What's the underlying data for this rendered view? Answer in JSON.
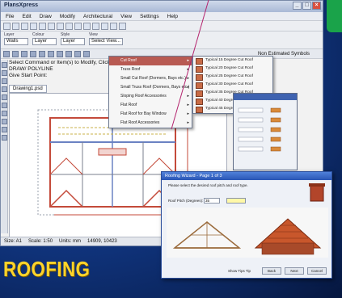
{
  "app": {
    "title": "PlansXpress",
    "menu": [
      "File",
      "Edit",
      "Draw",
      "Modify",
      "Architectural",
      "View",
      "Settings",
      "Help"
    ],
    "props": {
      "layer_label": "Layer",
      "layer_value": "Walls",
      "colour_label": "Colour",
      "colour_value": "Layer",
      "style_label": "Style",
      "style_value": "Layer",
      "view_label": "View",
      "view_value": "Select View..."
    },
    "non_estimated": "Non Estimated Symbols",
    "command_lines": [
      "Select Command or Item(s) to Modify, Click & Drag",
      "DRAW/ POLYLINE",
      "Give Start Point:"
    ],
    "tab": "Drawing1.psd",
    "status": {
      "sheet": "Size: A1",
      "scale": "Scale: 1:50",
      "units": "Units: mm",
      "coords": "14909, 10423"
    }
  },
  "menu_popup": {
    "items": [
      "Cut Roof",
      "Truss Roof",
      "Small Cut Roof (Dormers, Bays etc.)",
      "Small Truss Roof (Dormers, Bays etc.)",
      "Sloping Roof Accessories",
      "Flat Roof",
      "Flat Roof for Bay Window",
      "Flat Roof Accessories"
    ],
    "selected_index": 0
  },
  "submenu": {
    "items": [
      "Typical 15 Degree Cut Roof",
      "Typical 20 Degree Cut Roof",
      "Typical 25 Degree Cut Roof",
      "Typical 30 Degree Cut Roof",
      "Typical 35 Degree Cut Roof",
      "Typical 40 Degree Cut Roof",
      "Typical 45 Degree Cut Roof"
    ]
  },
  "dialog": {
    "title": "Roofing Wizard - Page 1 of 3",
    "intro": "Please select the desired roof pitch and roof type.",
    "pitch_label": "Roof Pitch (Degrees):",
    "pitch_value": "35",
    "footer": "Show Tips Tip",
    "buttons": [
      "Back",
      "Next",
      "Cancel"
    ]
  },
  "label": "ROOFING",
  "colors": {
    "accent": "#ffd42a",
    "menu_selected": "#b85a52",
    "roof_tiles": "#c8572c"
  }
}
